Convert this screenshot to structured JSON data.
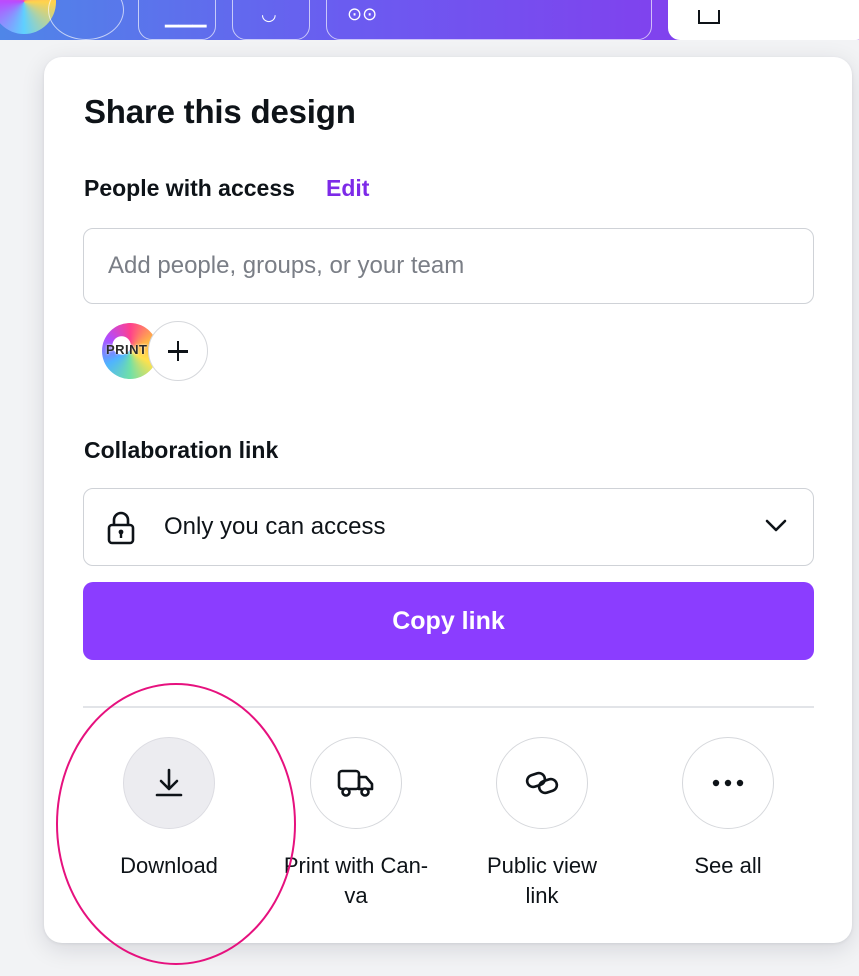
{
  "share_panel": {
    "title": "Share this design",
    "people_label": "People with access",
    "edit_label": "Edit",
    "add_people_placeholder": "Add people, groups, or your team",
    "member_avatar_text": "PRINT",
    "collaboration_label": "Collaboration link",
    "access_value": "Only you can access",
    "copy_link_label": "Copy link",
    "options": [
      {
        "label": "Download",
        "icon": "download-icon"
      },
      {
        "label": "Print with Can-\nva",
        "icon": "truck-icon"
      },
      {
        "label": "Public view\nlink",
        "icon": "link-icon"
      },
      {
        "label": "See all",
        "icon": "more-icon"
      }
    ]
  },
  "colors": {
    "accent": "#8b3dff",
    "edit_link": "#7d2ae8",
    "annotation": "#e6117e"
  }
}
